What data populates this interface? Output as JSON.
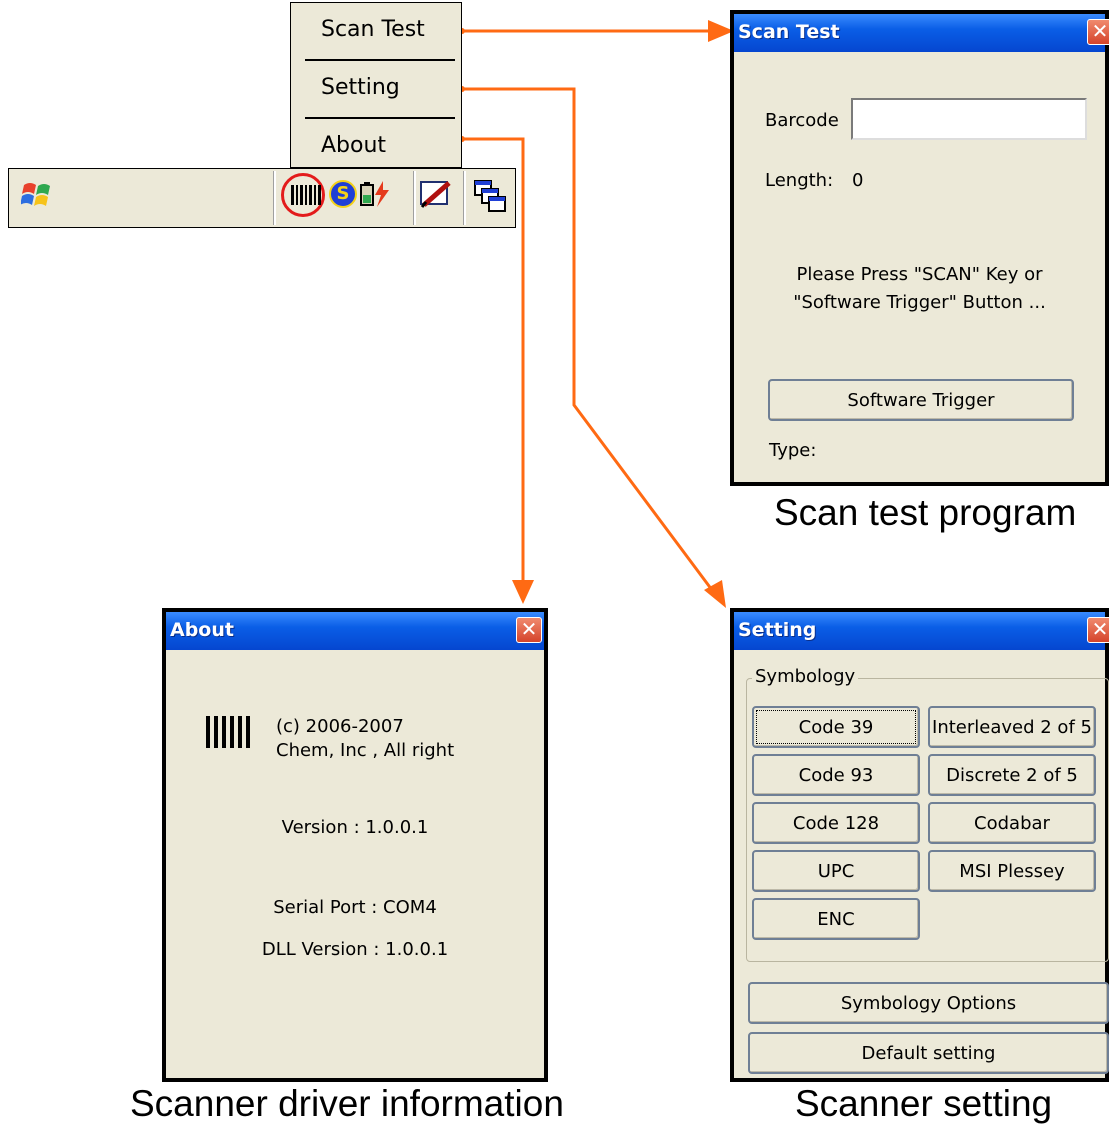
{
  "menu": {
    "items": [
      {
        "label": "Scan Test"
      },
      {
        "label": "Setting"
      },
      {
        "label": "About"
      }
    ]
  },
  "taskbar": {
    "icons": [
      "windows-start-icon",
      "barcode-icon",
      "s-icon",
      "battery-icon",
      "pen-icon",
      "windows-switch-icon"
    ]
  },
  "scan_test": {
    "title": "Scan Test",
    "barcode_label": "Barcode",
    "barcode_value": "",
    "length_label": "Length:",
    "length_value": "0",
    "instruction_line1": "Please Press \"SCAN\" Key or",
    "instruction_line2": "\"Software Trigger\" Button ...",
    "trigger_button": "Software Trigger",
    "type_label": "Type:",
    "caption": "Scan test program"
  },
  "about": {
    "title": "About",
    "copyright": "(c) 2006-2007",
    "company": "Chem, Inc , All right",
    "version": "Version : 1.0.0.1",
    "serial_port": "Serial Port : COM4",
    "dll_version": "DLL Version : 1.0.0.1",
    "caption": "Scanner driver information"
  },
  "setting": {
    "title": "Setting",
    "group_label": "Symbology",
    "symbologies": [
      "Code 39",
      "Interleaved 2 of 5",
      "Code 93",
      "Discrete 2 of 5",
      "Code 128",
      "Codabar",
      "UPC",
      "MSI Plessey",
      "ENC"
    ],
    "options_button": "Symbology Options",
    "default_button": "Default setting",
    "caption": "Scanner setting"
  },
  "colors": {
    "arrow": "#ff6a13",
    "titlebar": "#0a5ee6",
    "window_bg": "#ece9d8"
  }
}
